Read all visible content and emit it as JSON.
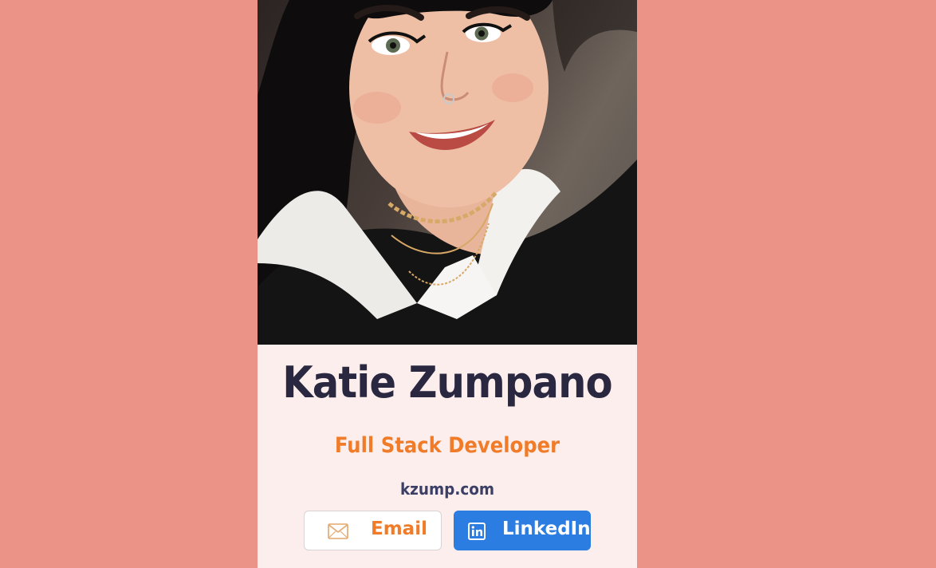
{
  "profile": {
    "name": "Katie Zumpano",
    "title": "Full Stack Developer",
    "website": "kzump.com",
    "photo_alt": "Portrait photo"
  },
  "buttons": {
    "email": {
      "label": "Email",
      "icon": "envelope-icon"
    },
    "linkedin": {
      "label": "LinkedIn",
      "icon": "linkedin-icon"
    }
  },
  "colors": {
    "page_background": "#ec9387",
    "card_background": "#fceeec",
    "name_text": "#2a2840",
    "title_text": "#f07c2a",
    "link_text": "#3b3f66",
    "linkedin_blue": "#2b7de1"
  }
}
